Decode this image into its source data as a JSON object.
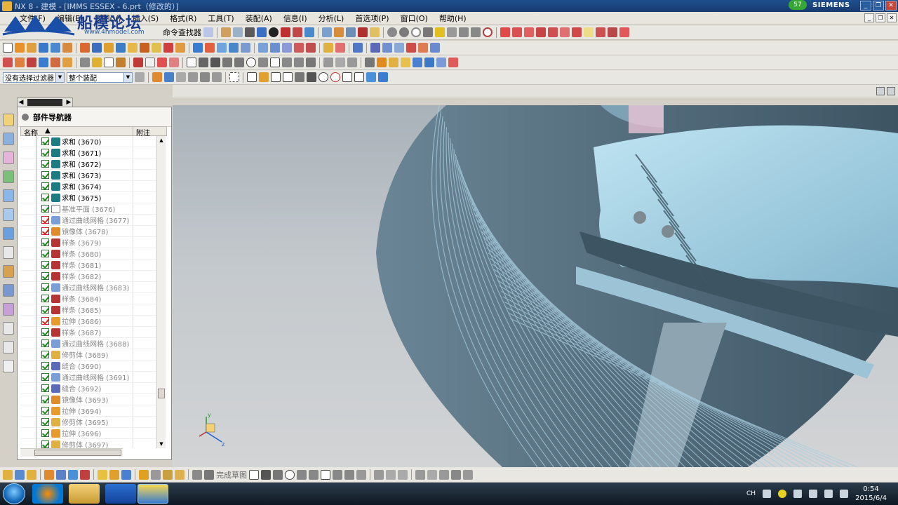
{
  "window": {
    "title": "NX 8 - 建模 - [IMMS ESSEX - 6.prt（修改的）]",
    "notification_count": "57",
    "brand": "SIEMENS"
  },
  "watermark": {
    "text": "船模论坛",
    "url": "www.4hmodel.com"
  },
  "menu": {
    "items": [
      "文件(F)",
      "编辑(E)",
      "视图(V)",
      "插入(S)",
      "格式(R)",
      "工具(T)",
      "装配(A)",
      "信息(I)",
      "分析(L)",
      "首选项(P)",
      "窗口(O)",
      "帮助(H)"
    ]
  },
  "toolbar": {
    "command_finder_label": "命令查找器",
    "selection_filter": "没有选择过滤器",
    "assembly_scope": "整个装配",
    "finish_sketch_label": "完成草图"
  },
  "navigator": {
    "title": "部件导航器",
    "col_name": "名称",
    "col_note": "附注",
    "rows": [
      {
        "name": "求和 (3670)",
        "dim": false,
        "err": false,
        "color": "#1b7d83"
      },
      {
        "name": "求和 (3671)",
        "dim": false,
        "err": false,
        "color": "#1b7d83"
      },
      {
        "name": "求和 (3672)",
        "dim": false,
        "err": false,
        "color": "#1b7d83"
      },
      {
        "name": "求和 (3673)",
        "dim": false,
        "err": false,
        "color": "#1b7d83"
      },
      {
        "name": "求和 (3674)",
        "dim": false,
        "err": false,
        "color": "#1b7d83"
      },
      {
        "name": "求和 (3675)",
        "dim": false,
        "err": false,
        "color": "#1b7d83"
      },
      {
        "name": "基准平面 (3676)",
        "dim": true,
        "err": false,
        "color": "#ffffff"
      },
      {
        "name": "通过曲线网格 (3677)",
        "dim": true,
        "err": true,
        "color": "#7a9fd8"
      },
      {
        "name": "镜像体 (3678)",
        "dim": true,
        "err": true,
        "color": "#e08a2a"
      },
      {
        "name": "样条 (3679)",
        "dim": true,
        "err": false,
        "color": "#b83434"
      },
      {
        "name": "样条 (3680)",
        "dim": true,
        "err": false,
        "color": "#b83434"
      },
      {
        "name": "样条 (3681)",
        "dim": true,
        "err": false,
        "color": "#b83434"
      },
      {
        "name": "样条 (3682)",
        "dim": true,
        "err": false,
        "color": "#b83434"
      },
      {
        "name": "通过曲线网格 (3683)",
        "dim": true,
        "err": false,
        "color": "#7a9fd8"
      },
      {
        "name": "样条 (3684)",
        "dim": true,
        "err": false,
        "color": "#b83434"
      },
      {
        "name": "样条 (3685)",
        "dim": true,
        "err": false,
        "color": "#b83434"
      },
      {
        "name": "拉伸 (3686)",
        "dim": true,
        "err": true,
        "color": "#e89a2c"
      },
      {
        "name": "样条 (3687)",
        "dim": true,
        "err": false,
        "color": "#b83434"
      },
      {
        "name": "通过曲线网格 (3688)",
        "dim": true,
        "err": false,
        "color": "#7a9fd8"
      },
      {
        "name": "修剪体 (3689)",
        "dim": true,
        "err": false,
        "color": "#e0b040"
      },
      {
        "name": "缝合 (3690)",
        "dim": true,
        "err": false,
        "color": "#5a6ab8"
      },
      {
        "name": "通过曲线网格 (3691)",
        "dim": true,
        "err": false,
        "color": "#7a9fd8"
      },
      {
        "name": "缝合 (3692)",
        "dim": true,
        "err": false,
        "color": "#5a6ab8"
      },
      {
        "name": "镜像体 (3693)",
        "dim": true,
        "err": false,
        "color": "#e08a2a"
      },
      {
        "name": "拉伸 (3694)",
        "dim": true,
        "err": false,
        "color": "#e89a2c"
      },
      {
        "name": "修剪体 (3695)",
        "dim": true,
        "err": false,
        "color": "#e0b040"
      },
      {
        "name": "拉伸 (3696)",
        "dim": true,
        "err": false,
        "color": "#e89a2c"
      },
      {
        "name": "修剪体 (3697)",
        "dim": true,
        "err": false,
        "color": "#e0b040"
      }
    ]
  },
  "triad": {
    "x": "x",
    "y": "y",
    "z": "z"
  },
  "taskbar": {
    "lang": "CH",
    "time": "0:54",
    "date": "2015/6/4"
  },
  "colors": {
    "hull": "#5f7a8c",
    "hull_light": "#8fb7cd",
    "interior": "#a9d8ea"
  }
}
